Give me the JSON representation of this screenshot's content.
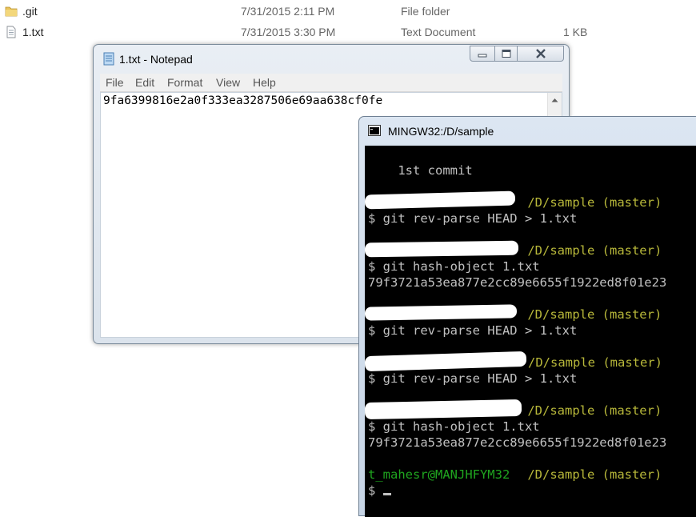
{
  "explorer": {
    "files": [
      {
        "name": ".git",
        "date": "7/31/2015 2:11 PM",
        "type": "File folder",
        "size": "",
        "icon": "folder-icon"
      },
      {
        "name": "1.txt",
        "date": "7/31/2015 3:30 PM",
        "type": "Text Document",
        "size": "1 KB",
        "icon": "text-file-icon"
      }
    ]
  },
  "notepad": {
    "title": "1.txt - Notepad",
    "menu": [
      "File",
      "Edit",
      "Format",
      "View",
      "Help"
    ],
    "content": "9fa6399816e2a0f333ea3287506e69aa638cf0fe",
    "icon": "notepad-icon"
  },
  "terminal": {
    "title": "MINGW32:/D/sample",
    "icon": "terminal-icon",
    "lines": {
      "l0": "    1st commit",
      "p1": " /D/sample (master)",
      "c1": "$ git rev-parse HEAD > 1.txt",
      "p2": " /D/sample (master)",
      "c2": "$ git hash-object 1.txt",
      "o2": "79f3721a53ea877e2cc89e6655f1922ed8f01e23",
      "p3": " /D/sample (master)",
      "c3": "$ git rev-parse HEAD > 1.txt",
      "p4": "/D/sample (master)",
      "c4": "$ git rev-parse HEAD > 1.txt",
      "p5": " /D/sample (master)",
      "c5": "$ git hash-object 1.txt",
      "o5": "79f3721a53ea877e2cc89e6655f1922ed8f01e23",
      "user": "t_mahesr@MANJHFYM32",
      "p6": " /D/sample (master)",
      "prompt": "$ "
    }
  }
}
